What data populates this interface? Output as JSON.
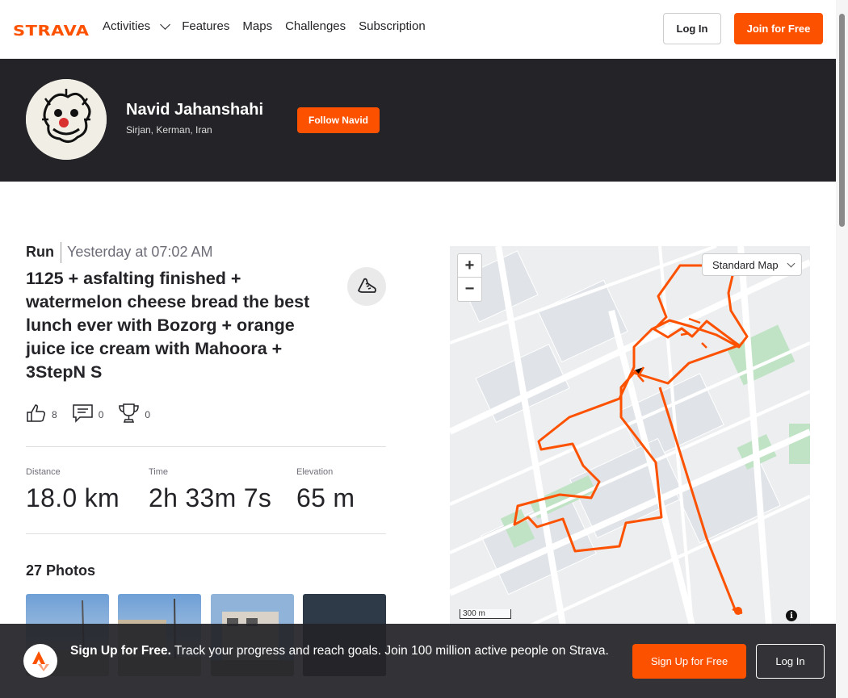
{
  "nav": {
    "logo": "STRAVA",
    "items": [
      "Activities",
      "Features",
      "Maps",
      "Challenges",
      "Subscription"
    ],
    "login": "Log In",
    "join": "Join for Free"
  },
  "athlete": {
    "name": "Navid Jahanshahi",
    "location": "Sirjan, Kerman, Iran",
    "follow": "Follow Navid"
  },
  "activity": {
    "type": "Run",
    "date": "Yesterday at 07:02 AM",
    "title": "1125 + asfalting finished + watermelon cheese bread the best lunch ever with Bozorg + orange juice ice cream with Mahoora + 3StepN S",
    "kudos": "8",
    "comments": "0",
    "achievements": "0",
    "stats": [
      {
        "label": "Distance",
        "value": "18.0 km"
      },
      {
        "label": "Time",
        "value": "2h 33m 7s"
      },
      {
        "label": "Elevation",
        "value": "65 m"
      }
    ],
    "photos_title": "27 Photos"
  },
  "map": {
    "zoom_in": "+",
    "zoom_out": "−",
    "style": "Standard Map",
    "scale": "300 m",
    "info": "i",
    "route_color": "#fc5200"
  },
  "banner": {
    "bold": "Sign Up for Free.",
    "text": "Track your progress and reach goals. Join 100 million active people on Strava.",
    "signup": "Sign Up for Free",
    "login": "Log In"
  },
  "colors": {
    "brand": "#fc5200",
    "dark": "#242428"
  }
}
